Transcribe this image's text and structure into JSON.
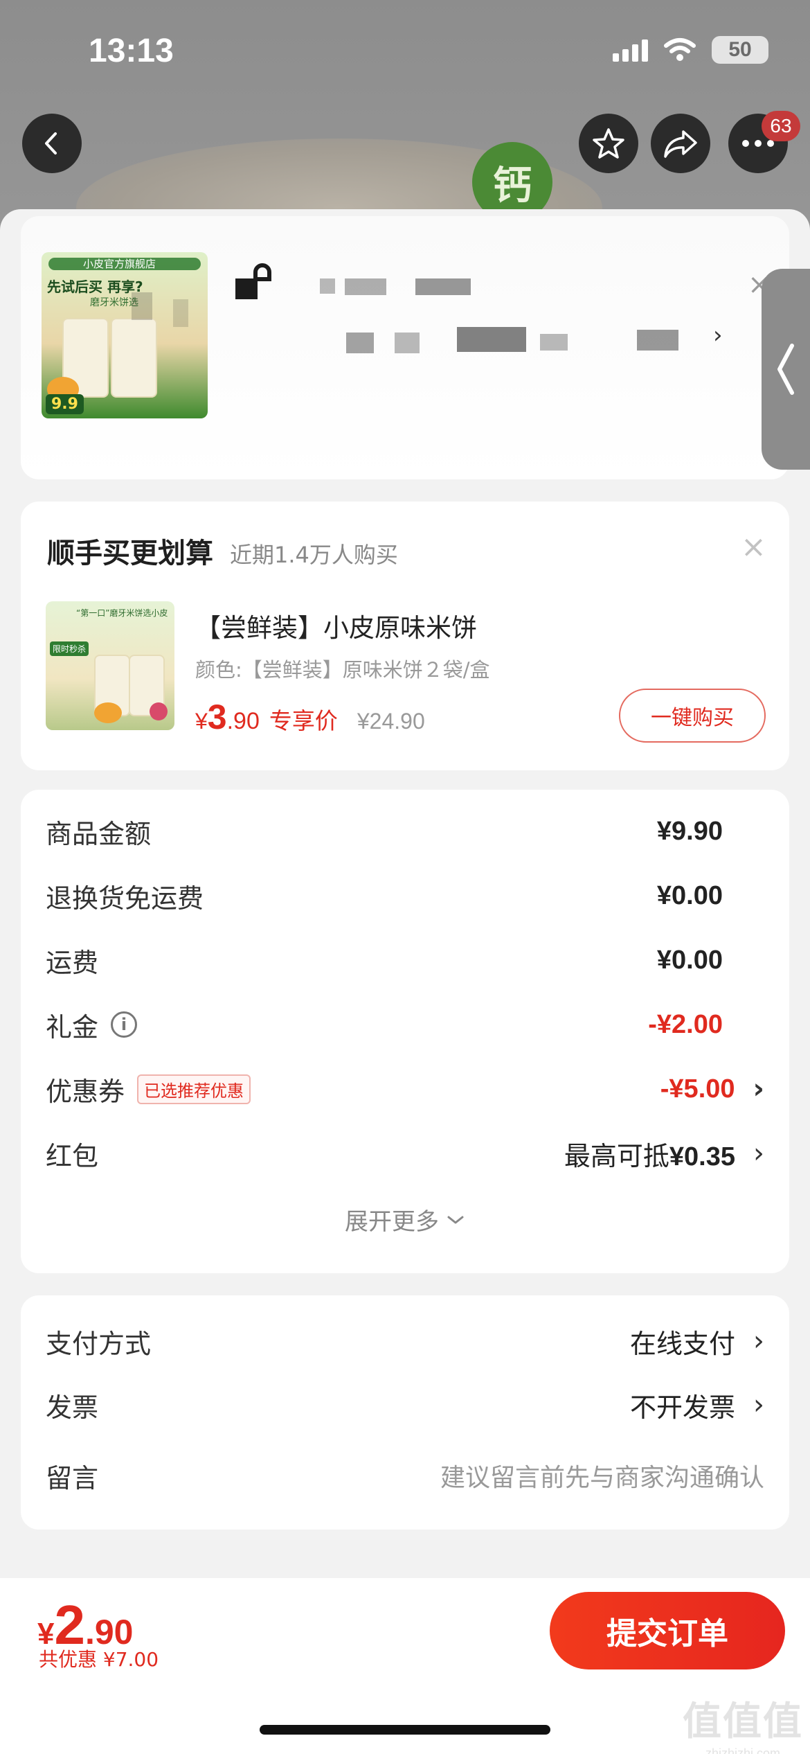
{
  "status_bar": {
    "time": "13:13",
    "battery": "50"
  },
  "header": {
    "cart_badge": "63",
    "calcium_badge": "钙"
  },
  "addon": {
    "section_title": "顺手买更划算",
    "section_subtitle": "近期1.4万人购买",
    "product_name": "【尝鲜装】小皮原味米饼",
    "product_spec": "颜色:【尝鲜装】原味米饼２袋/盒",
    "price_symbol": "¥",
    "price_main": "3",
    "price_decimal": ".90",
    "price_label": "专享价",
    "original_price": "¥24.90",
    "buy_button": "一键购买",
    "thumb_brand": "“第一口”磨牙米饼选小皮",
    "thumb_tag": "限时秒杀"
  },
  "main_product": {
    "thumb_store": "小皮官方旗舰店",
    "thumb_slogan": "先试后买 再享?",
    "thumb_sub": "磨牙米饼选",
    "thumb_price": "9.9"
  },
  "summary": {
    "rows": [
      {
        "label": "商品金额",
        "value": "¥9.90"
      },
      {
        "label": "退换货免运费",
        "value": "¥0.00"
      },
      {
        "label": "运费",
        "value": "¥0.00"
      },
      {
        "label": "礼金",
        "value": "-¥2.00"
      },
      {
        "label": "优惠券",
        "tag": "已选推荐优惠",
        "value": "-¥5.00"
      },
      {
        "label": "红包",
        "value_prefix": "最高可抵",
        "value": "¥0.35"
      }
    ],
    "expand_more": "展开更多"
  },
  "payment": {
    "method_label": "支付方式",
    "method_value": "在线支付",
    "invoice_label": "发票",
    "invoice_value": "不开发票",
    "note_label": "留言",
    "note_placeholder": "建议留言前先与商家沟通确认"
  },
  "bottom": {
    "total_symbol": "¥",
    "total_main": "2",
    "total_decimal": ".90",
    "discount_total": "共优惠 ¥7.00",
    "submit_button": "提交订单"
  },
  "watermark": {
    "site": "zhizhizhi.com",
    "glyphs": "值值值"
  }
}
